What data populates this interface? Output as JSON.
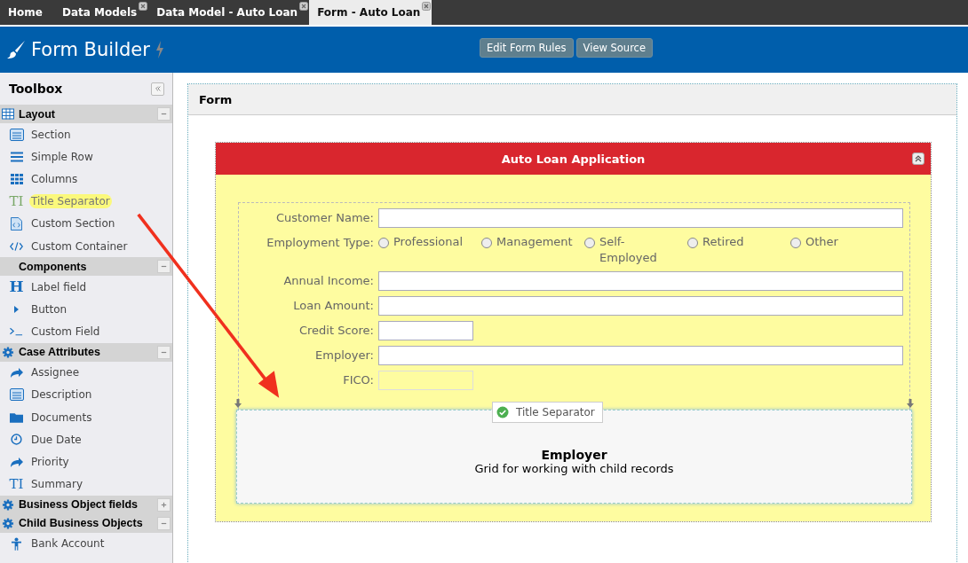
{
  "tabs": [
    {
      "label": "Home",
      "selected": false,
      "closable": false
    },
    {
      "label": "Data Models",
      "selected": false,
      "closable": true
    },
    {
      "label": "Data Model - Auto Loan",
      "selected": false,
      "closable": true
    },
    {
      "label": "Form - Auto Loan",
      "selected": true,
      "closable": true
    }
  ],
  "header": {
    "title": "Form Builder",
    "buttons": [
      "Edit Form Rules",
      "View Source"
    ]
  },
  "toolbox": {
    "title": "Toolbox",
    "groups": [
      {
        "name": "Layout",
        "kind": "grid",
        "expanded": true,
        "items": [
          {
            "label": "Section",
            "kind": "panel",
            "highlighted": false
          },
          {
            "label": "Simple Row",
            "kind": "lines",
            "highlighted": false
          },
          {
            "label": "Columns",
            "kind": "grid",
            "highlighted": false
          },
          {
            "label": "Title Separator",
            "kind": "title",
            "glyph": "TI",
            "highlighted": true
          },
          {
            "label": "Custom Section",
            "kind": "file",
            "highlighted": false
          },
          {
            "label": "Custom Container",
            "kind": "code",
            "highlighted": false
          }
        ]
      },
      {
        "name": "Components",
        "kind": "none",
        "expanded": true,
        "items": [
          {
            "label": "Label field",
            "kind": "h",
            "glyph": "H",
            "highlighted": false
          },
          {
            "label": "Button",
            "kind": "play",
            "highlighted": false
          },
          {
            "label": "Custom Field",
            "kind": "prompt",
            "highlighted": false
          }
        ]
      },
      {
        "name": "Case Attributes",
        "kind": "gear",
        "expanded": true,
        "items": [
          {
            "label": "Assignee",
            "kind": "share",
            "highlighted": false
          },
          {
            "label": "Description",
            "kind": "panel",
            "highlighted": false
          },
          {
            "label": "Documents",
            "kind": "folder",
            "highlighted": false
          },
          {
            "label": "Due Date",
            "kind": "clock",
            "highlighted": false
          },
          {
            "label": "Priority",
            "kind": "share",
            "highlighted": false
          },
          {
            "label": "Summary",
            "kind": "title",
            "glyph": "TI",
            "highlighted": false
          }
        ]
      },
      {
        "name": "Business Object fields",
        "kind": "gear",
        "expanded": false
      },
      {
        "name": "Child Business Objects",
        "kind": "gear",
        "expanded": true,
        "items": [
          {
            "label": "Bank Account",
            "kind": "person",
            "highlighted": false
          }
        ]
      }
    ]
  },
  "form": {
    "title": "Form",
    "section": {
      "title": "Auto Loan Application",
      "fields": [
        {
          "label": "Customer Name:",
          "kind": "wide",
          "disabled": false
        },
        {
          "label": "Employment Type:",
          "kind": "radio",
          "options": [
            {
              "label": "Professional",
              "selected": false
            },
            {
              "label": "Management",
              "selected": false
            },
            {
              "label": "Self-\nEmployed",
              "selected": false
            },
            {
              "label": "Retired",
              "selected": false
            },
            {
              "label": "Other",
              "selected": false
            }
          ]
        },
        {
          "label": "Annual Income:",
          "kind": "wide",
          "disabled": false
        },
        {
          "label": "Loan Amount:",
          "kind": "wide",
          "disabled": false
        },
        {
          "label": "Credit Score:",
          "kind": "short",
          "disabled": false
        },
        {
          "label": "Employer:",
          "kind": "wide",
          "disabled": false
        },
        {
          "label": "FICO:",
          "kind": "short",
          "disabled": true
        }
      ],
      "drop": {
        "tooltip": "Title Separator",
        "title": "Employer",
        "text": "Grid for working with child records"
      }
    }
  }
}
